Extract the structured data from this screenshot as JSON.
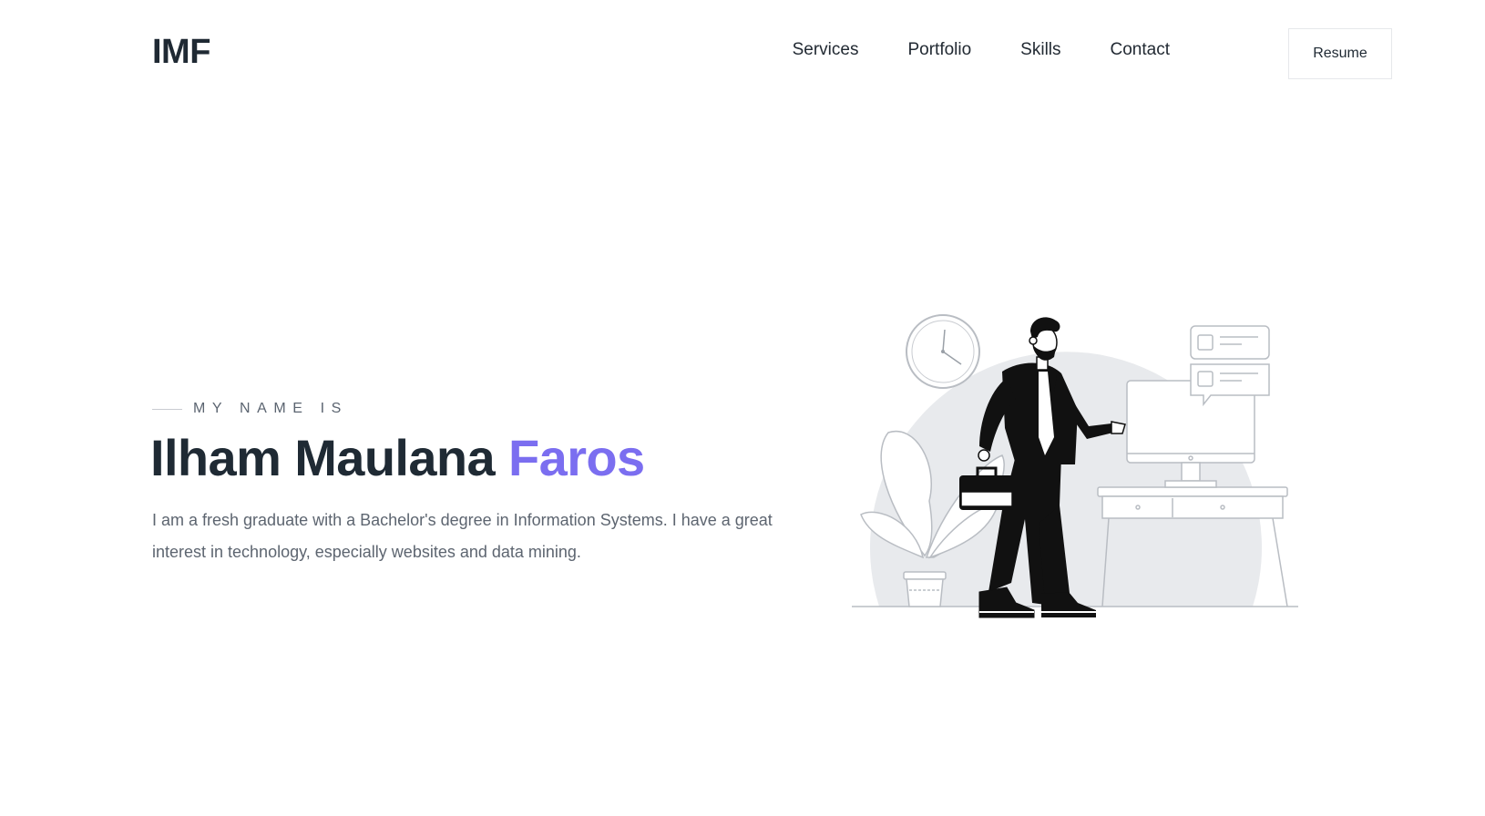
{
  "header": {
    "logo": "IMF",
    "nav": [
      {
        "label": "Services"
      },
      {
        "label": "Portfolio"
      },
      {
        "label": "Skills"
      },
      {
        "label": "Contact"
      }
    ],
    "resume_label": "Resume"
  },
  "hero": {
    "eyebrow": "MY NAME IS",
    "name_main": "Ilham Maulana ",
    "name_accent": "Faros",
    "description": "I am a fresh graduate with a Bachelor's degree in Information Systems. I have a great interest in technology, especially websites and data mining."
  },
  "colors": {
    "accent": "#7b6ef0",
    "heading": "#1f2a34",
    "body_text": "#5d6570",
    "illustration_bg": "#e8eaed"
  },
  "illustration": {
    "icons": [
      "wall-clock-icon",
      "plant-icon",
      "monitor-icon",
      "chat-bubble-icon",
      "desk-icon",
      "person-with-briefcase-icon"
    ]
  }
}
